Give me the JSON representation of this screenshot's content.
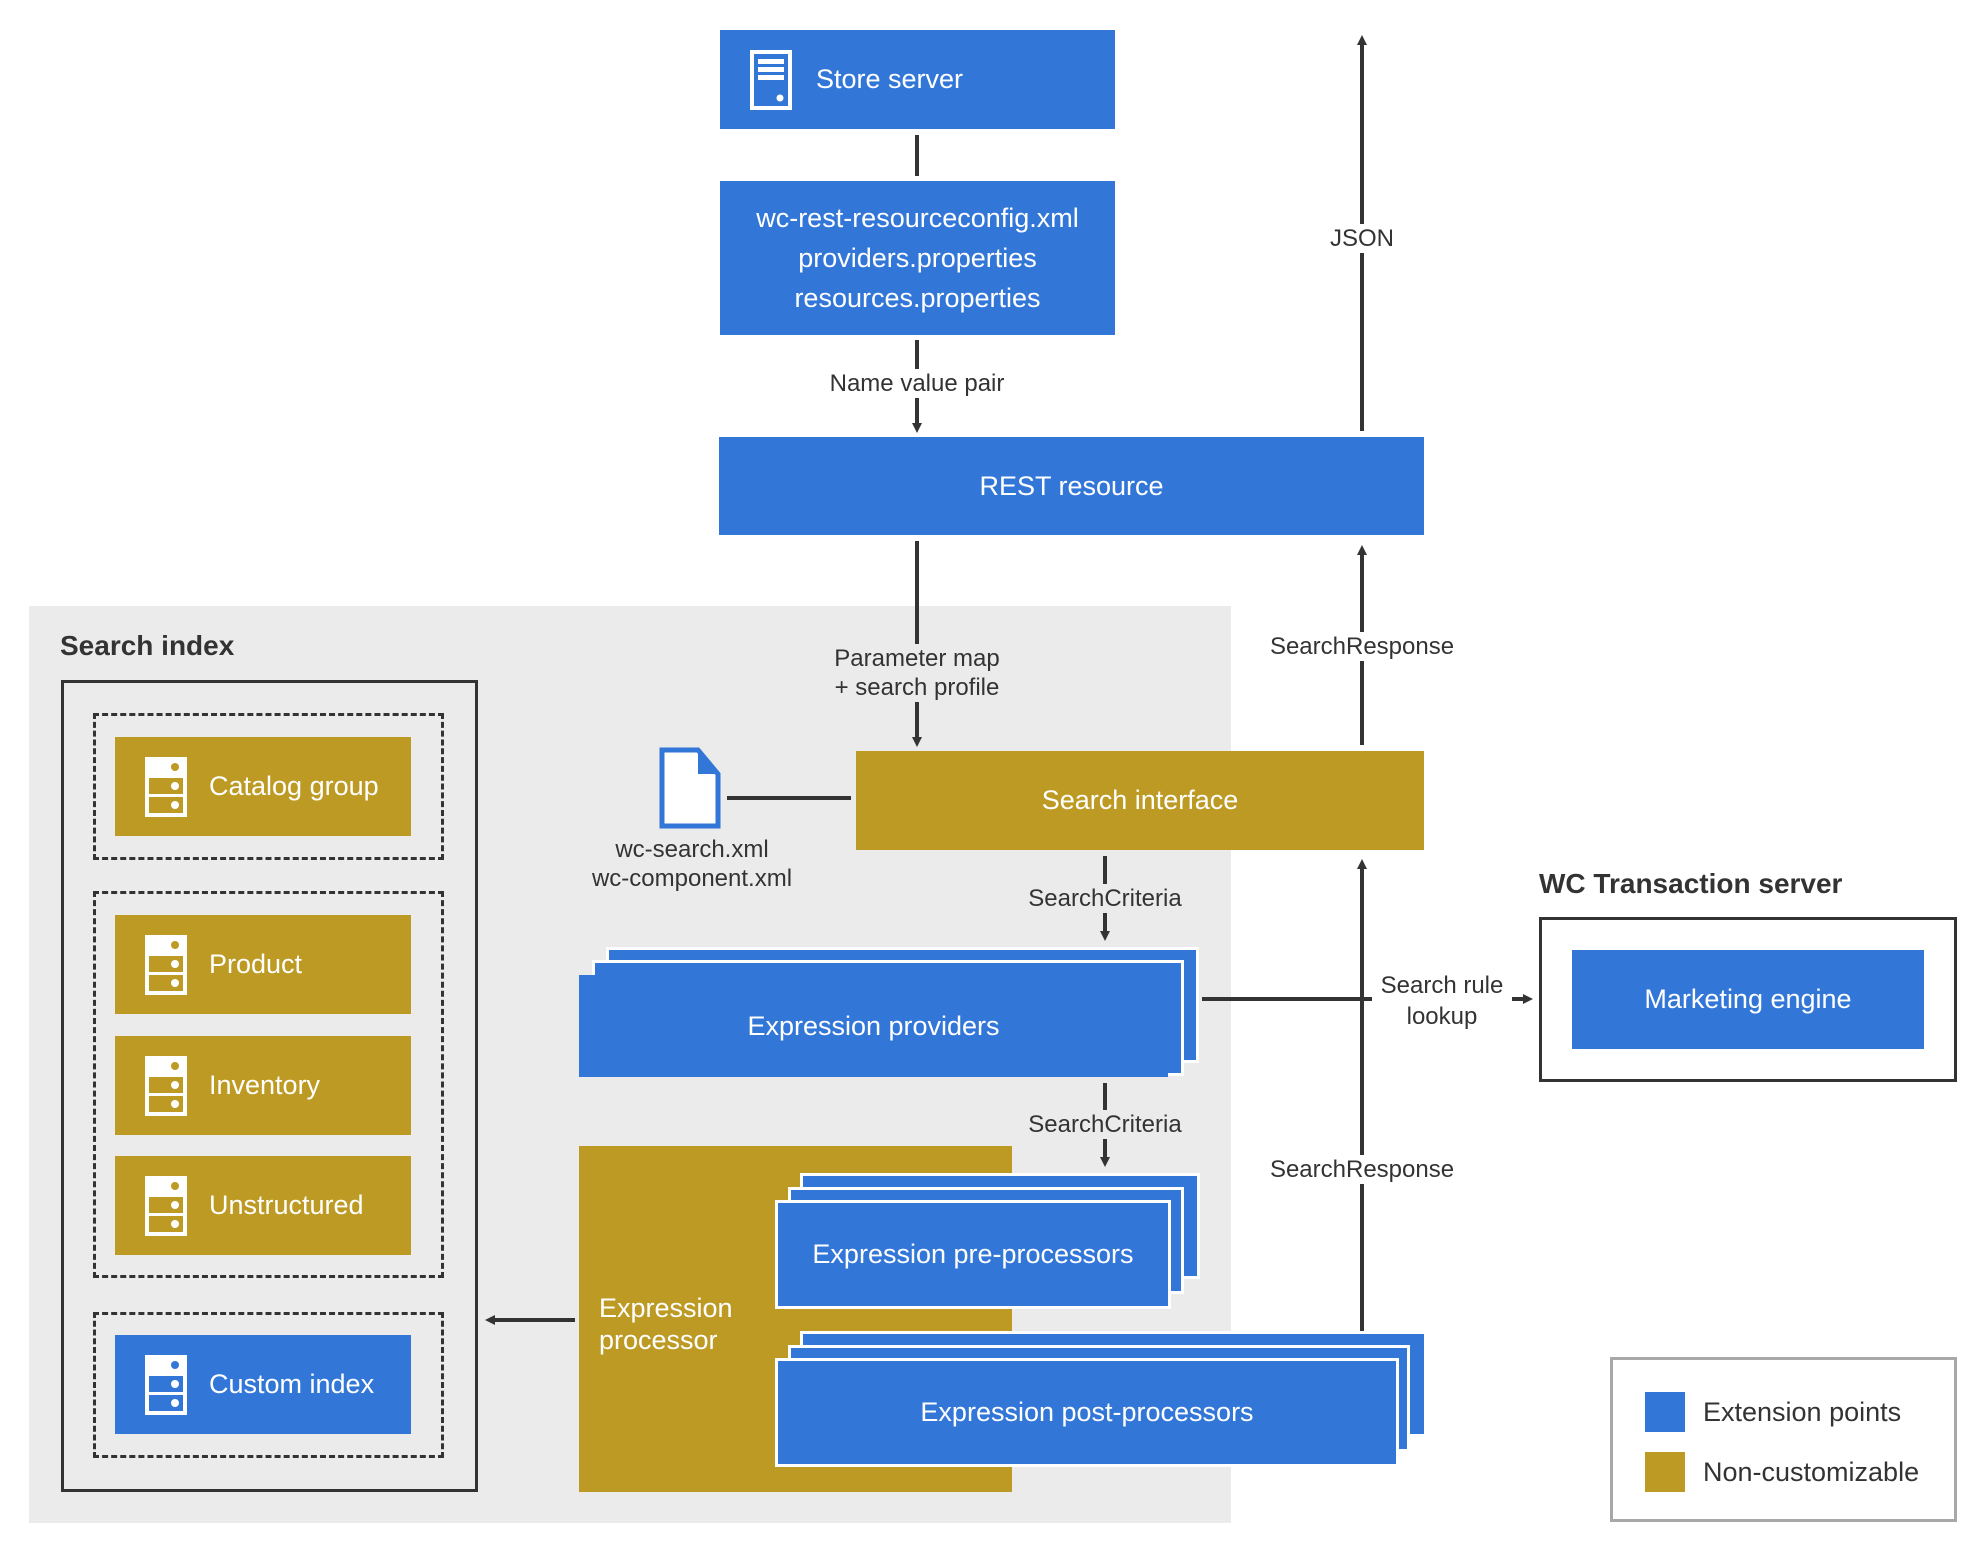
{
  "colors": {
    "extension_blue": "#3277d8",
    "non_customizable_gold": "#bd9a23",
    "panel_gray": "#ebebeb",
    "line_dark": "#333333"
  },
  "top": {
    "store_server": {
      "label": "Store server",
      "icon": "server-icon"
    },
    "config_files": [
      "wc-rest-resourceconfig.xml",
      "providers.properties",
      "resources.properties"
    ],
    "name_value_pair": "Name value pair",
    "rest_resource": "REST resource",
    "json_label": "JSON"
  },
  "search_index": {
    "title": "Search index",
    "groups": [
      {
        "items": [
          {
            "label": "Catalog group",
            "type": "non-customizable",
            "icon": "database-icon"
          }
        ]
      },
      {
        "items": [
          {
            "label": "Product",
            "type": "non-customizable",
            "icon": "database-icon"
          },
          {
            "label": "Inventory",
            "type": "non-customizable",
            "icon": "database-icon"
          },
          {
            "label": "Unstructured",
            "type": "non-customizable",
            "icon": "database-icon"
          }
        ]
      },
      {
        "items": [
          {
            "label": "Custom index",
            "type": "extension",
            "icon": "database-icon"
          }
        ]
      }
    ]
  },
  "flow": {
    "parameter_map": [
      "Parameter map",
      "+ search profile"
    ],
    "search_response_top": "SearchResponse",
    "search_interface": "Search interface",
    "config_xml": [
      "wc-search.xml",
      "wc-component.xml"
    ],
    "search_criteria_1": "SearchCriteria",
    "expression_providers": "Expression providers",
    "search_criteria_2": "SearchCriteria",
    "search_response_bottom": "SearchResponse",
    "expression_processor": [
      "Expression",
      "processor"
    ],
    "pre_processors": "Expression pre-processors",
    "post_processors": "Expression post-processors",
    "search_rule_lookup": [
      "Search rule",
      "lookup"
    ]
  },
  "wc_server": {
    "title": "WC Transaction server",
    "marketing_engine": "Marketing engine"
  },
  "legend": [
    {
      "label": "Extension points",
      "color": "#3277d8"
    },
    {
      "label": "Non-customizable",
      "color": "#bd9a23"
    }
  ]
}
